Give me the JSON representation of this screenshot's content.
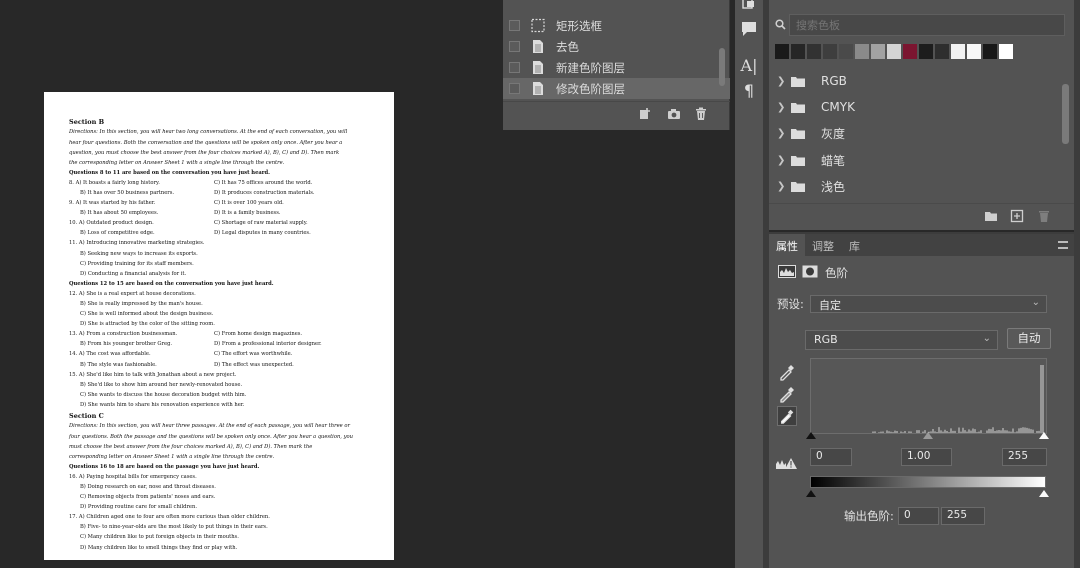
{
  "document": {
    "section_b_title": "Section B",
    "section_b_directions_1": "Directions: In this section, you will hear two long conversations. At the end of each conversation, you will",
    "section_b_directions_2": "hear four questions. Both the conversation and the questions will be spoken only once. After you hear a",
    "section_b_directions_3": "question, you must choose the best answer from the four choices marked A), B), C) and D). Then mark",
    "section_b_directions_4": "the corresponding letter on Answer Sheet 1 with a single line through the centre.",
    "q8_11_head": "Questions 8 to 11 are based on the conversation you have just heard.",
    "q8a": "8. A) It boasts a fairly long history.",
    "q8c": "C) It has 75 offices around the world.",
    "q8b": "B) It has over 50 business partners.",
    "q8d": "D) It produces construction materials.",
    "q9a": "9. A) It was started by his father.",
    "q9c": "C) It is over 100 years old.",
    "q9b": "B) It has about 50 employees.",
    "q9d": "D) It is a family business.",
    "q10a": "10. A) Outdated product design.",
    "q10c": "C) Shortage of raw material supply.",
    "q10b": "B) Loss of competitive edge.",
    "q10d": "D) Legal disputes in many countries.",
    "q11a": "11. A) Introducing innovative marketing strategies.",
    "q11b": "B) Seeking new ways to increase its exports.",
    "q11c": "C) Providing training for its staff members.",
    "q11d": "D) Conducting a financial analysis for it.",
    "q12_15_head": "Questions 12 to 15 are based on the conversation you have just heard.",
    "q12a": "12. A) She is a real expert at house decorations.",
    "q12b": "B) She is really impressed by the man's house.",
    "q12c": "C) She is well informed about the design business.",
    "q12d": "D) She is attracted by the color of the sitting room.",
    "q13a": "13. A) From a construction businessman.",
    "q13c": "C) From home design magazines.",
    "q13b": "B) From his younger brother Greg.",
    "q13d": "D) From a professional interior designer.",
    "q14a": "14. A) The cost was affordable.",
    "q14c": "C) The effort was worthwhile.",
    "q14b": "B) The style was fashionable.",
    "q14d": "D) The effect was unexpected.",
    "q15a": "15. A) She'd like him to talk with Jonathan about a new project.",
    "q15b": "B) She'd like to show him around her newly-renovated house.",
    "q15c": "C) She wants to discuss the house decoration budget with him.",
    "q15d": "D) She wants him to share his renovation experience with her.",
    "section_c_title": "Section C",
    "section_c_directions_1": "Directions: In this section, you will hear three passages. At the end of each passage, you will hear three or",
    "section_c_directions_2": "four questions. Both the passage and the questions will be spoken only once. After you hear a question, you",
    "section_c_directions_3": "must choose the best answer from the four choices marked A), B), C) and D). Then mark the",
    "section_c_directions_4": "corresponding letter on Answer Sheet 1 with a single line through the centre.",
    "q16_18_head": "Questions 16 to 18 are based on the passage you have just heard.",
    "q16a": "16. A) Paying hospital bills for emergency cases.",
    "q16b": "B) Doing research on ear, nose and throat diseases.",
    "q16c": "C) Removing objects from patients' noses and ears.",
    "q16d": "D) Providing routine care for small children.",
    "q17a": "17. A) Children aged one to four are often more curious than older children.",
    "q17b": "B) Five- to nine-year-olds are the most likely to put things in their ears.",
    "q17c": "C) Many children like to put foreign objects in their mouths.",
    "q17d": "D) Many children like to smell things they find or play with."
  },
  "layers": {
    "items": [
      {
        "name": "矩形选框"
      },
      {
        "name": "去色"
      },
      {
        "name": "新建色阶图层"
      },
      {
        "name": "修改色阶图层"
      }
    ]
  },
  "swatches": {
    "search_placeholder": "搜索色板",
    "colors": [
      "#1a1a1a",
      "#262626",
      "#323232",
      "#3e3e3e",
      "#4a4a4a",
      "#8a8a8a",
      "#a2a2a2",
      "#d4d4d4",
      "#7b1530",
      "#1d1d1d",
      "#2e2e2e",
      "#f2f2f2",
      "#f8f8f8",
      "#181818",
      "#ffffff"
    ],
    "groups": [
      {
        "name": "RGB"
      },
      {
        "name": "CMYK"
      },
      {
        "name": "灰度"
      },
      {
        "name": "蜡笔"
      },
      {
        "name": "浅色"
      }
    ]
  },
  "properties": {
    "tabs": [
      "属性",
      "调整",
      "库"
    ],
    "title": "色阶",
    "preset_label": "预设:",
    "preset_value": "自定",
    "channel_value": "RGB",
    "auto_button": "自动",
    "input_black": "0",
    "input_gamma": "1.00",
    "input_white": "255",
    "output_label": "输出色阶:",
    "output_black": "0",
    "output_white": "255"
  }
}
